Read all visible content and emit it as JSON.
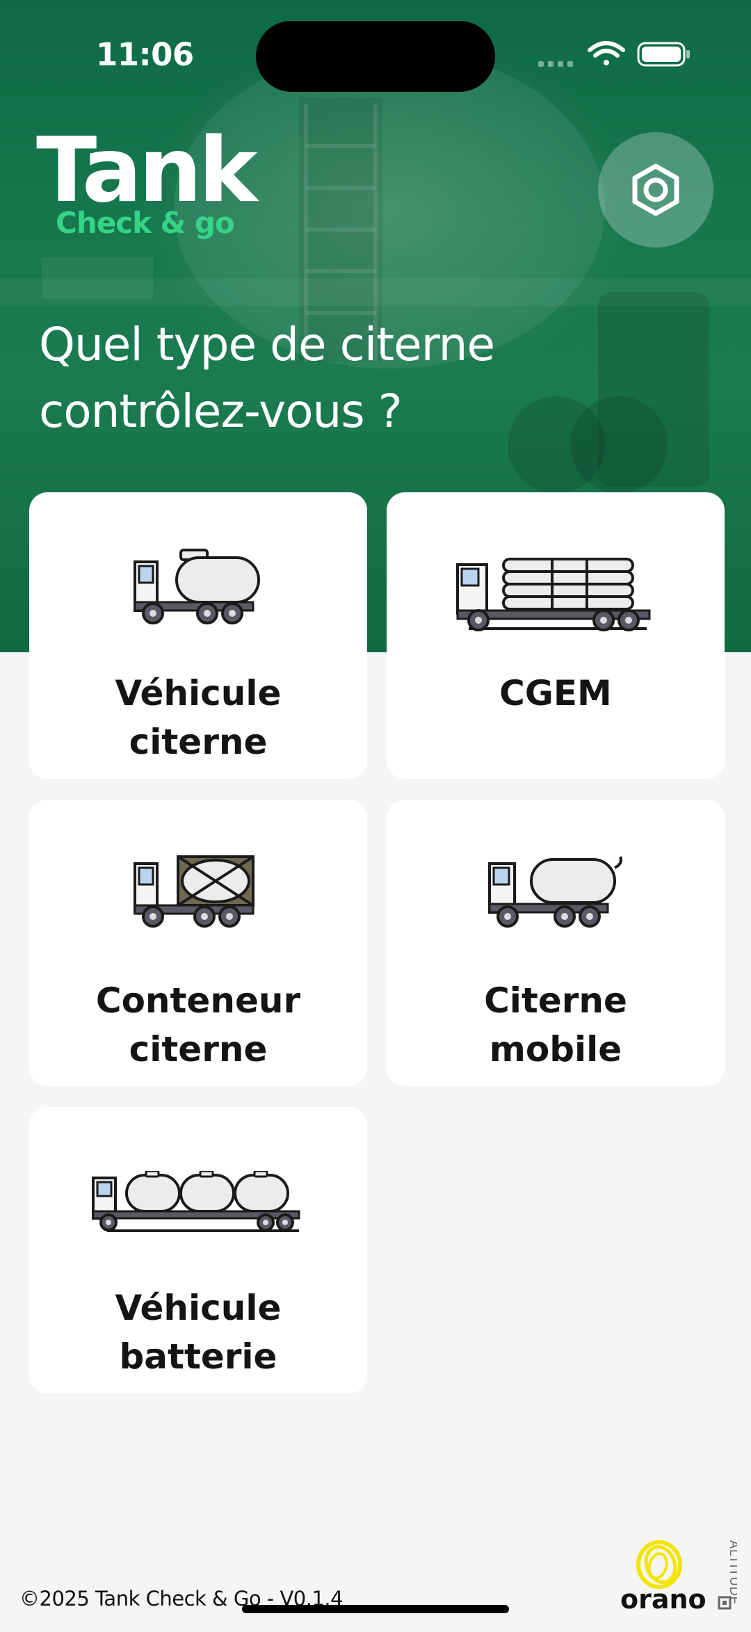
{
  "status_bar": {
    "time": "11:06"
  },
  "logo": {
    "title": "Tank",
    "subtitle": "Check & go"
  },
  "headline": {
    "line1": "Quel type de citerne",
    "line2": "contrôlez-vous ?"
  },
  "tank_types": [
    {
      "line1": "Véhicule",
      "line2": "citerne",
      "icon": "tank-truck-icon"
    },
    {
      "line1": "",
      "line2": "CGEM",
      "icon": "cgem-truck-icon"
    },
    {
      "line1": "Conteneur",
      "line2": "citerne",
      "icon": "tank-container-icon"
    },
    {
      "line1": "Citerne",
      "line2": "mobile",
      "icon": "mobile-tank-icon"
    },
    {
      "line1": "Véhicule",
      "line2": "batterie",
      "icon": "battery-vehicle-icon"
    }
  ],
  "footer": {
    "copyright": "©2025 Tank Check & Go - V0.1.4",
    "brand": "orano",
    "partner": "ALTITUDE"
  },
  "colors": {
    "hero_green": "#17784f",
    "accent_green": "#35d487",
    "card_bg": "#ffffff",
    "page_bg": "#f5f5f5"
  }
}
